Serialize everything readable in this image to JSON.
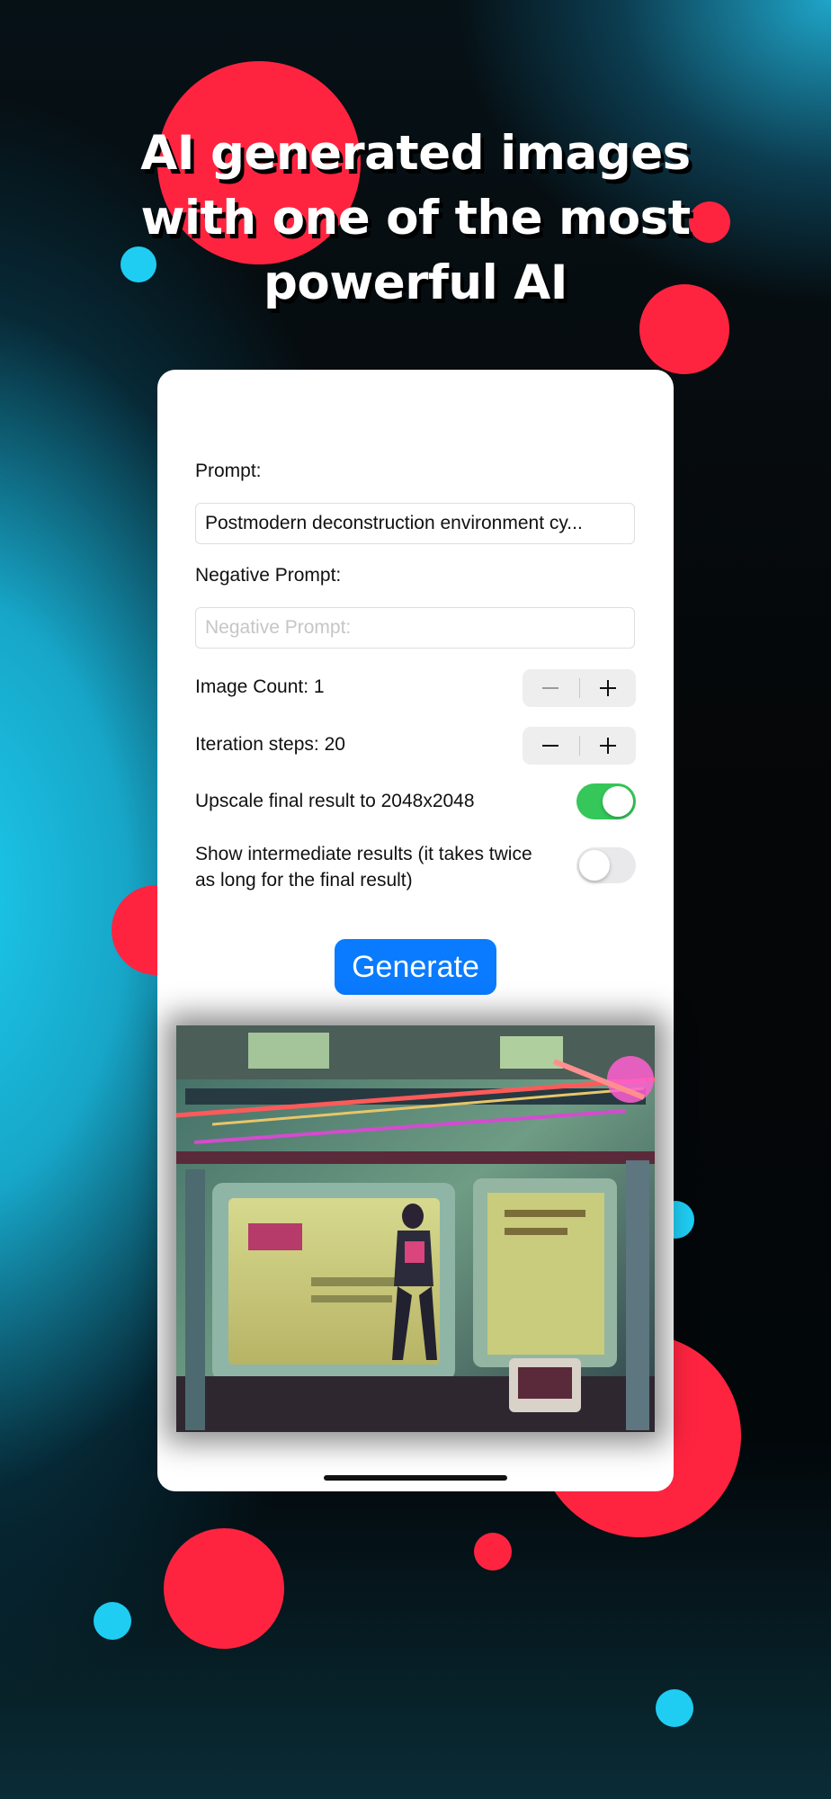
{
  "headline": {
    "line1": "AI generated images",
    "line2": "with one of the most",
    "line3": "powerful AI"
  },
  "form": {
    "prompt_label": "Prompt:",
    "prompt_value": "Postmodern deconstruction environment cy...",
    "negative_label": "Negative Prompt:",
    "negative_placeholder": "Negative Prompt:",
    "image_count_label": "Image Count: 1",
    "iteration_label": "Iteration steps: 20",
    "upscale_label": "Upscale final result to 2048x2048",
    "upscale_on": true,
    "intermediate_label_1": "Show intermediate results (it takes twice",
    "intermediate_label_2": "as long for the final result)",
    "intermediate_on": false,
    "generate_label": "Generate"
  },
  "colors": {
    "accent_red": "#fe2440",
    "accent_blue": "#1fcdf3",
    "button_blue": "#0a7bff",
    "toggle_green": "#35c759"
  }
}
